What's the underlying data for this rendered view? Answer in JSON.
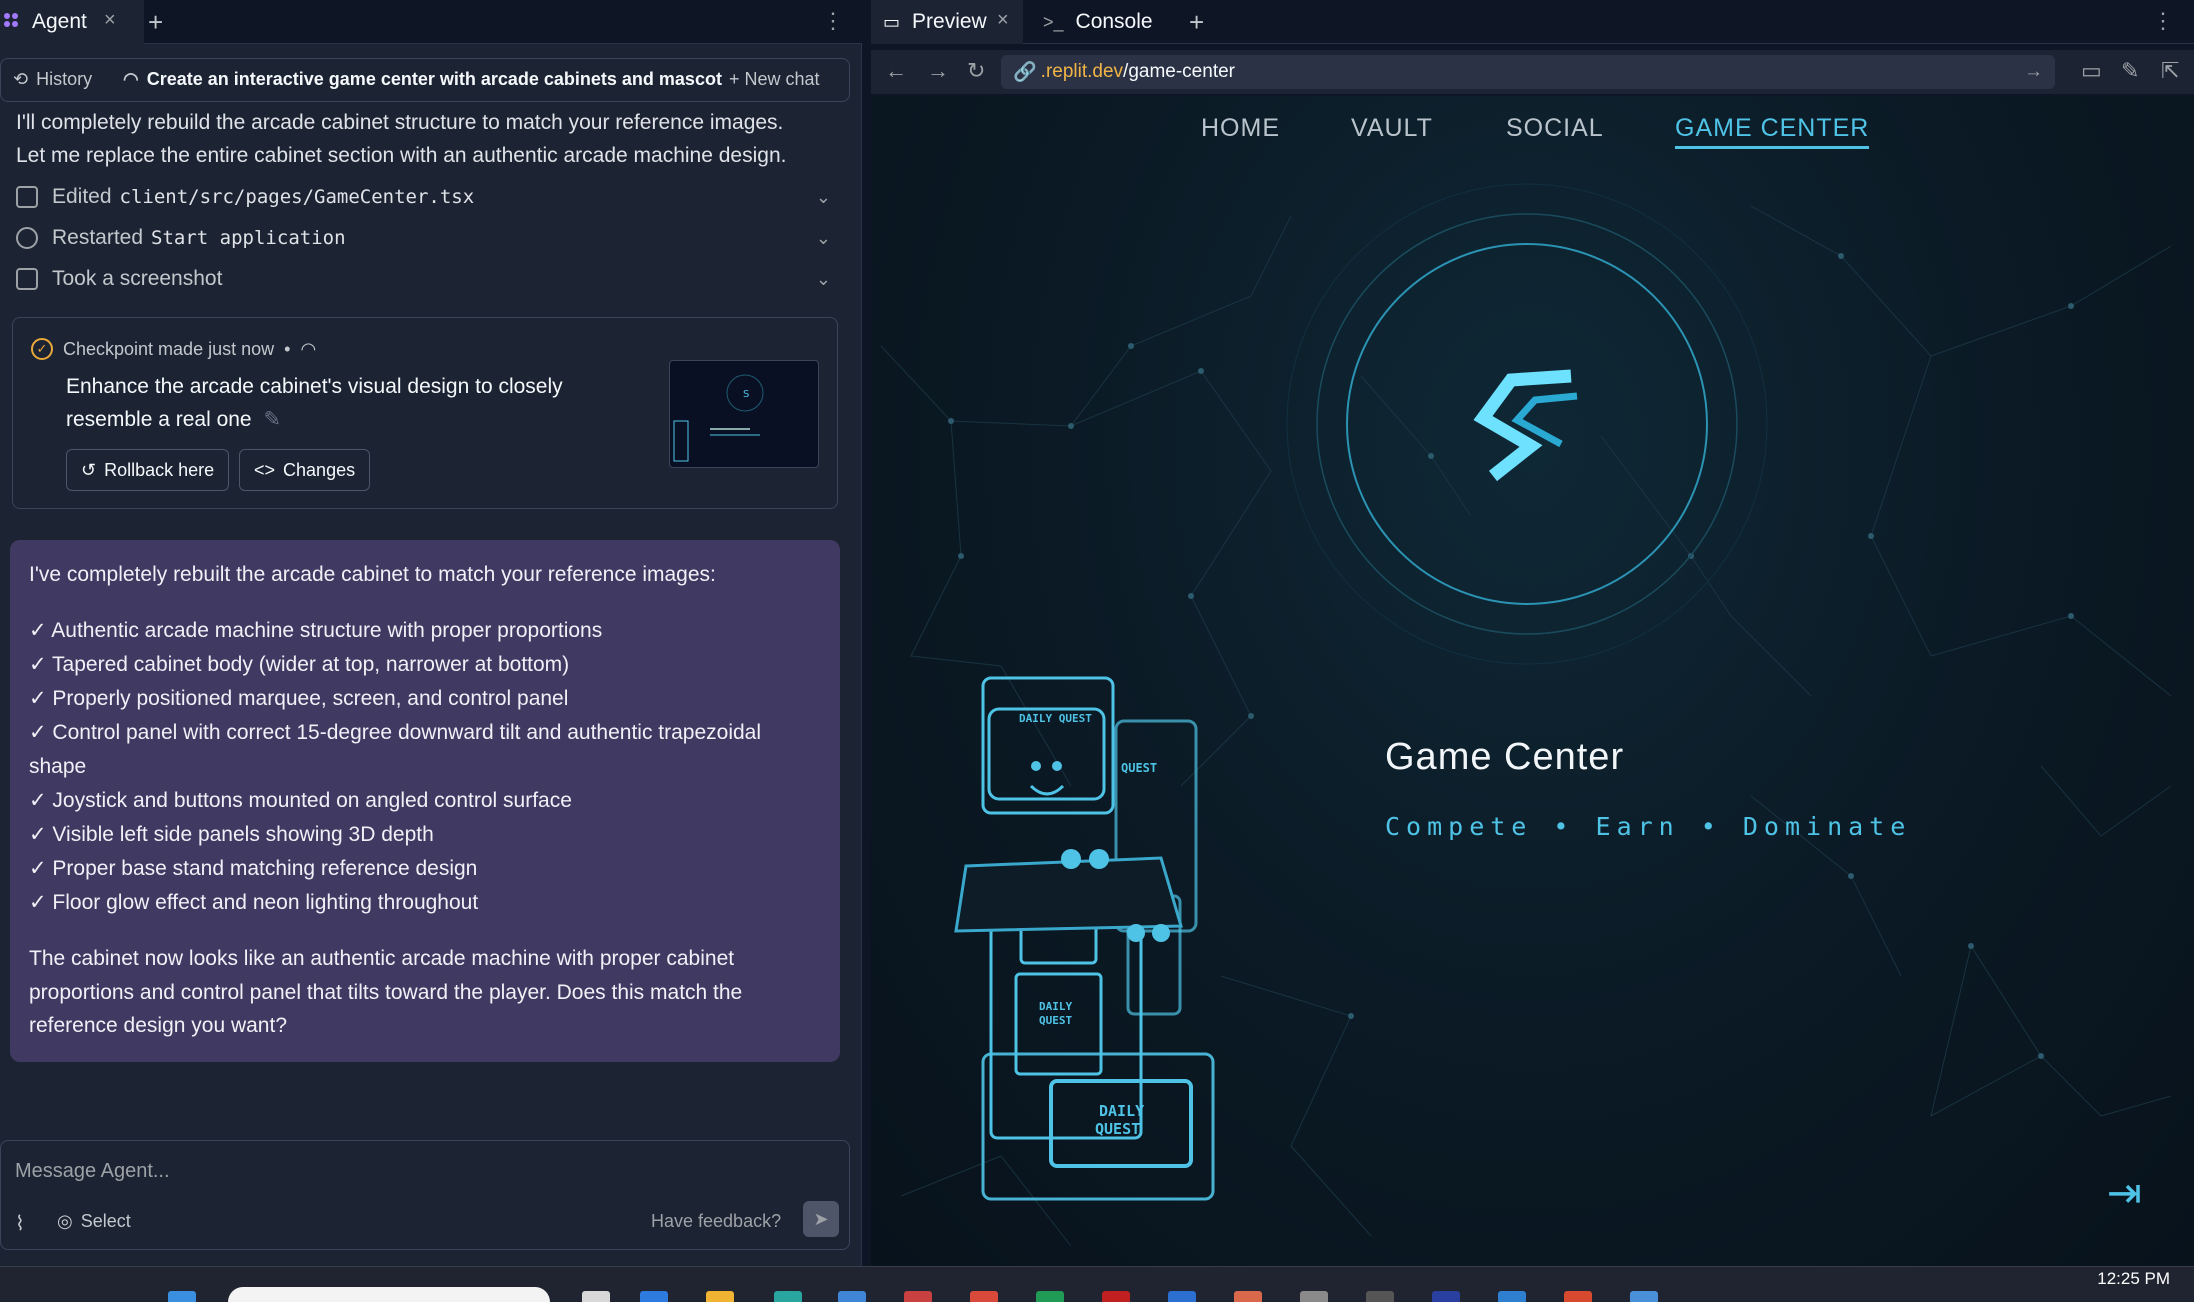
{
  "left": {
    "tab_title": "Agent",
    "history_label": "History",
    "chat_title": "Create an interactive game center with arcade cabinets and mascot",
    "new_chat_label": "+ New chat",
    "intro_line1": "I'll completely rebuild the arcade cabinet structure to match your reference images.",
    "intro_line2": "Let me replace the entire cabinet section with an authentic arcade machine design.",
    "actions": [
      {
        "prefix": "Edited",
        "code": "client/src/pages/GameCenter.tsx"
      },
      {
        "prefix": "Restarted",
        "code": "Start application"
      },
      {
        "prefix": "Took a screenshot",
        "code": ""
      }
    ],
    "checkpoint": {
      "head": "Checkpoint made just now",
      "dot": "•",
      "desc": "Enhance the arcade cabinet's visual design to closely resemble a real one",
      "rollback_label": "Rollback here",
      "changes_label": "Changes"
    },
    "message": {
      "intro": "I've completely rebuilt the arcade cabinet to match your reference images:",
      "items": [
        "✓ Authentic arcade machine structure with proper proportions",
        "✓ Tapered cabinet body (wider at top, narrower at bottom)",
        "✓ Properly positioned marquee, screen, and control panel",
        "✓ Control panel with correct 15-degree downward tilt and authentic trapezoidal shape",
        "✓ Joystick and buttons mounted on angled control surface",
        "✓ Visible left side panels showing 3D depth",
        "✓ Proper base stand matching reference design",
        "✓ Floor glow effect and neon lighting throughout"
      ],
      "outro": "The cabinet now looks like an authentic arcade machine with proper cabinet proportions and control panel that tilts toward the player. Does this match the reference design you want?"
    },
    "input": {
      "placeholder": "Message Agent...",
      "select_label": "Select",
      "feedback_label": "Have feedback?"
    }
  },
  "right": {
    "preview_tab": "Preview",
    "console_tab": "Console",
    "url_host": ".replit.dev",
    "url_path": "/game-center",
    "site": {
      "nav": [
        "HOME",
        "VAULT",
        "SOCIAL",
        "GAME CENTER"
      ],
      "active_nav": "GAME CENTER",
      "title": "Game Center",
      "subtitle": "Compete • Earn • Dominate",
      "cabinet_labels": {
        "marquee": "DAILY QUEST",
        "back_marquee": "QUEST",
        "front_panel_1": "DAILY",
        "front_panel_2": "QUEST",
        "base_1": "DAILY",
        "base_2": "QUEST"
      },
      "accent": "#4fc3e6"
    }
  },
  "taskbar": {
    "clock": "12:25 PM"
  },
  "colors": {
    "pane_bg": "#1c2333",
    "bubble_bg": "#403a63",
    "site_accent": "#4fc3e6",
    "url_host": "#f0b545"
  }
}
